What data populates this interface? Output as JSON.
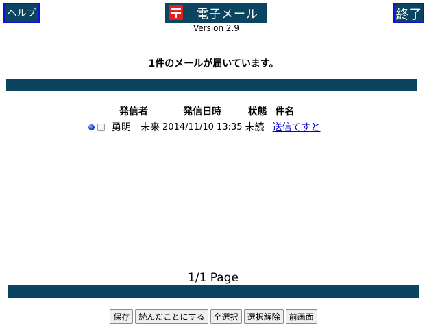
{
  "header": {
    "help_label": "ヘルプ",
    "title": "電子メール",
    "version": "Version 2.9",
    "exit_label": "終了"
  },
  "notice": "1件のメールが届いています。",
  "table": {
    "columns": [
      "発信者",
      "発信日時",
      "状態",
      "件名"
    ],
    "rows": [
      {
        "sender": "勇明　未来",
        "date": "2014/11/10 13:35",
        "status": "未読",
        "subject": "送信てすと"
      }
    ]
  },
  "pager": "1/1 Page",
  "actions": {
    "save": "保存",
    "mark_read": "読んだことにする",
    "select_all": "全選択",
    "deselect": "選択解除",
    "back": "前画面"
  },
  "colors": {
    "bar": "#0b4460",
    "nav_border": "#1010d8",
    "postal_red": "#e21e1e",
    "link": "#0000cc"
  },
  "icons": {
    "title": "postal-mark-icon",
    "unread": "unread-dot-icon"
  }
}
